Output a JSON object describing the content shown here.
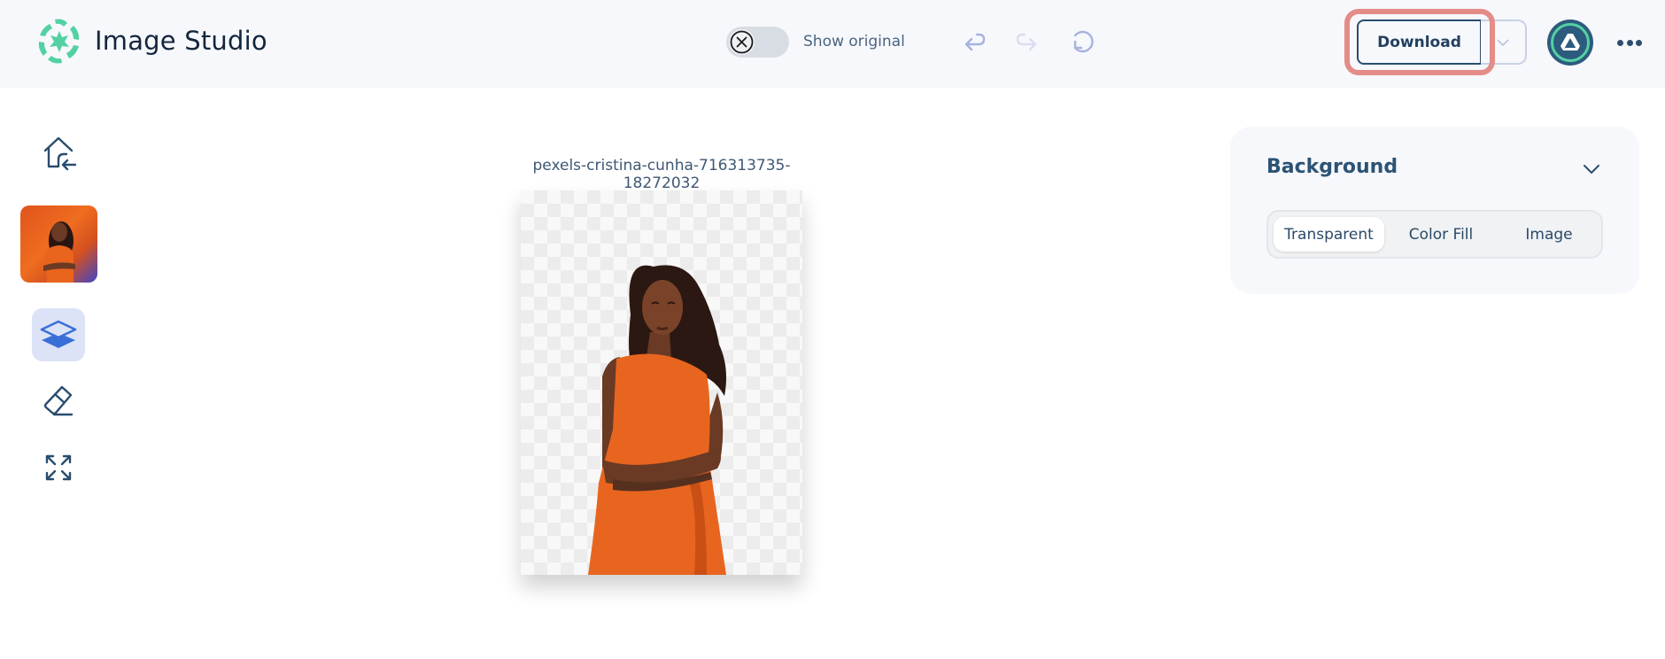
{
  "header": {
    "app_title": "Image Studio",
    "logo_icon": "sparkle-swirl-logo-icon",
    "show_original_label": "Show original",
    "show_original_enabled": false,
    "undo_icon": "undo-icon",
    "redo_icon": "redo-icon",
    "reset_icon": "reset-icon",
    "download_label": "Download",
    "download_menu_icon": "chevron-down-icon",
    "avatar_icon": "google-drive-icon",
    "more_icon": "more-horizontal-icon"
  },
  "sidebar": {
    "items": [
      {
        "name": "home",
        "icon": "home-back-icon"
      },
      {
        "name": "image-thumbnail",
        "icon": "thumbnail"
      },
      {
        "name": "layers",
        "icon": "layers-icon",
        "active": true
      },
      {
        "name": "eraser",
        "icon": "eraser-icon"
      },
      {
        "name": "expand",
        "icon": "expand-icon"
      }
    ]
  },
  "canvas": {
    "filename": "pexels-cristina-cunha-716313735-18272032",
    "background": "transparent"
  },
  "panel": {
    "title": "Background",
    "options": [
      "Transparent",
      "Color Fill",
      "Image"
    ],
    "selected": "Transparent"
  },
  "colors": {
    "header_bg": "#f7f8fc",
    "accent_green": "#53d1a3",
    "primary_navy": "#2a4d6e",
    "highlight": "#e48c87",
    "active_tab_bg": "#dce3f7",
    "active_icon": "#3a6fd8",
    "dress_orange": "#e8651f"
  }
}
